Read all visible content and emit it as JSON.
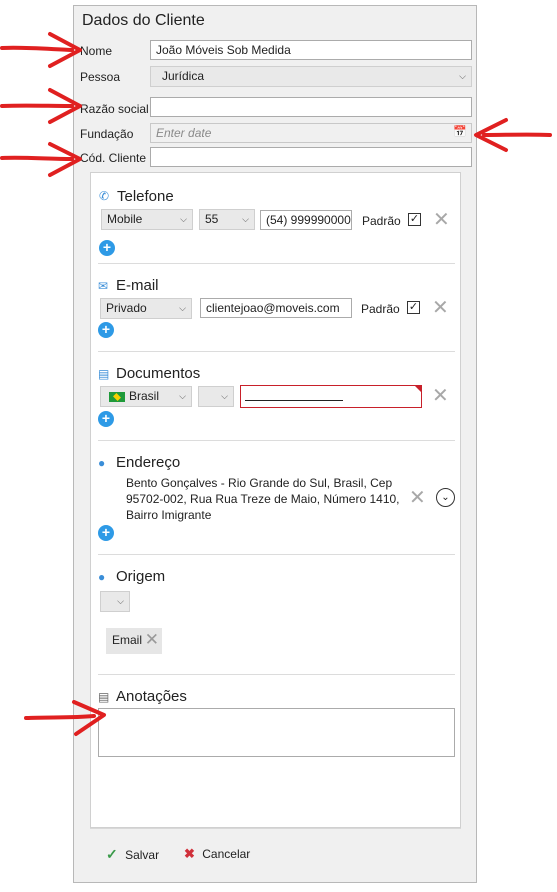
{
  "panel": {
    "title": "Dados do Cliente"
  },
  "fields": {
    "nome_label": "Nome",
    "nome_value": "João Móveis Sob Medida",
    "pessoa_label": "Pessoa",
    "pessoa_value": "Jurídica",
    "razao_label": "Razão social",
    "razao_value": "",
    "fundacao_label": "Fundação",
    "fundacao_placeholder": "Enter date",
    "cod_label": "Cód. Cliente",
    "cod_value": ""
  },
  "telefone": {
    "title": "Telefone",
    "type": "Mobile",
    "ddi": "55",
    "number": "(54) 999990000",
    "padrao_label": "Padrão",
    "padrao_checked": true
  },
  "email": {
    "title": "E-mail",
    "type": "Privado",
    "address": "clientejoao@moveis.com",
    "padrao_label": "Padrão",
    "padrao_checked": true
  },
  "documentos": {
    "title": "Documentos",
    "country": "Brasil",
    "doc_type": "",
    "doc_value": ""
  },
  "endereco": {
    "title": "Endereço",
    "line1": "Bento Gonçalves - Rio Grande do Sul, Brasil, Cep",
    "line2": "95702-002, Rua Rua Treze de Maio, Número 1410,",
    "line3": "Bairro Imigrante"
  },
  "origem": {
    "title": "Origem",
    "selected": "",
    "tag": "Email"
  },
  "anotacoes": {
    "title": "Anotações",
    "value": ""
  },
  "footer": {
    "save_label": "Salvar",
    "cancel_label": "Cancelar"
  },
  "colors": {
    "accent": "#2e9ae6",
    "annotation_arrow": "#e02020",
    "error_border": "#c8202a",
    "save_check": "#3a9a4a",
    "cancel_x": "#d0303a"
  }
}
